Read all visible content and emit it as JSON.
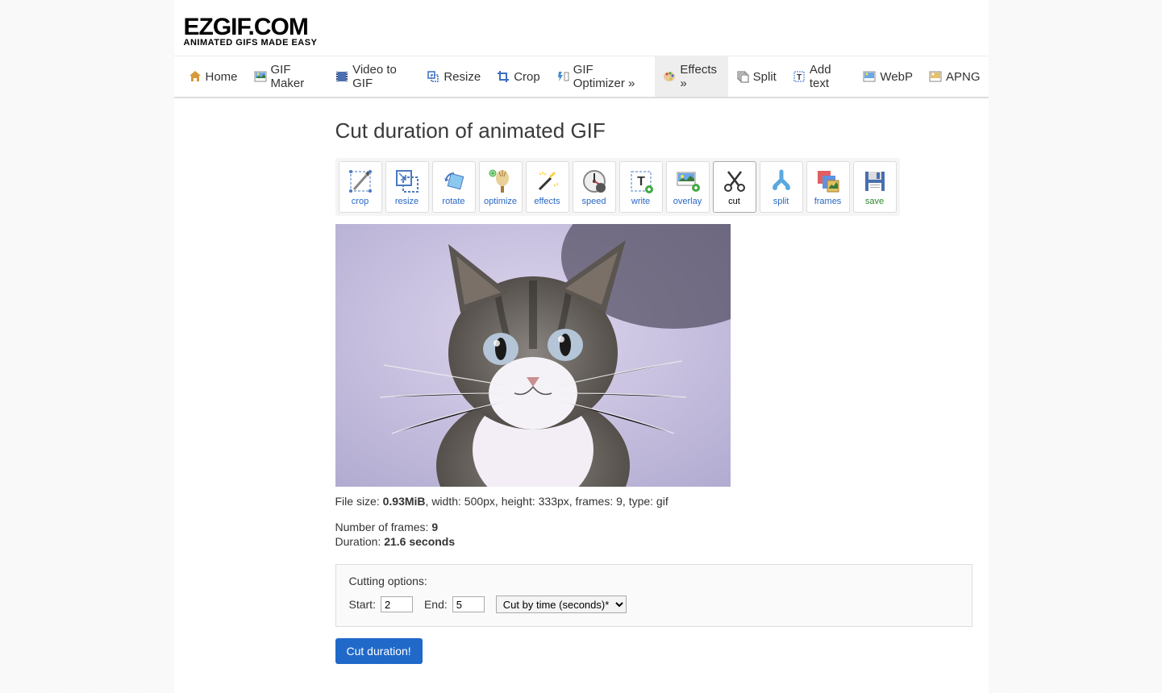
{
  "logo": {
    "main": "EZGIF.COM",
    "sub": "ANIMATED GIFS MADE EASY"
  },
  "nav": {
    "home": "Home",
    "gifmaker": "GIF Maker",
    "videotogif": "Video to GIF",
    "resize": "Resize",
    "crop": "Crop",
    "optimizer": "GIF Optimizer »",
    "effects": "Effects »",
    "split": "Split",
    "addtext": "Add text",
    "webp": "WebP",
    "apng": "APNG"
  },
  "page_title": "Cut duration of animated GIF",
  "tools": {
    "crop": "crop",
    "resize": "resize",
    "rotate": "rotate",
    "optimize": "optimize",
    "effects": "effects",
    "speed": "speed",
    "write": "write",
    "overlay": "overlay",
    "cut": "cut",
    "split": "split",
    "frames": "frames",
    "save": "save"
  },
  "meta": {
    "prefix": "File size: ",
    "size": "0.93MiB",
    "rest": ", width: 500px, height: 333px, frames: 9, type: gif"
  },
  "info": {
    "frames_label": "Number of frames: ",
    "frames_value": "9",
    "duration_label": "Duration: ",
    "duration_value": "21.6 seconds"
  },
  "options": {
    "title": "Cutting options:",
    "start_label": "Start:",
    "start_value": "2",
    "end_label": "End:",
    "end_value": "5",
    "mode_selected": "Cut by time (seconds)*"
  },
  "submit_label": "Cut duration!"
}
